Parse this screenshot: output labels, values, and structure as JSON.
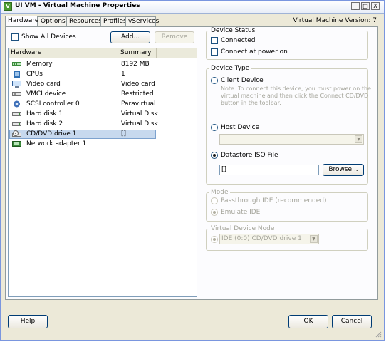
{
  "window": {
    "title": "UI VM - Virtual Machine Properties",
    "minimize": "_",
    "maximize": "□",
    "close": "X"
  },
  "tabs": [
    "Hardware",
    "Options",
    "Resources",
    "Profiles",
    "vServices"
  ],
  "version_label": "Virtual Machine Version: 7",
  "hardware": {
    "show_all_label": "Show All Devices",
    "show_all_checked": false,
    "add_label": "Add...",
    "remove_label": "Remove",
    "col_hardware": "Hardware",
    "col_summary": "Summary",
    "rows": [
      {
        "name": "Memory",
        "summary": "8192 MB",
        "icon": "memory-icon"
      },
      {
        "name": "CPUs",
        "summary": "1",
        "icon": "cpu-icon"
      },
      {
        "name": "Video card",
        "summary": "Video card",
        "icon": "video-card-icon"
      },
      {
        "name": "VMCI device",
        "summary": "Restricted",
        "icon": "vmci-device-icon"
      },
      {
        "name": "SCSI controller 0",
        "summary": "Paravirtual",
        "icon": "scsi-controller-icon"
      },
      {
        "name": "Hard disk 1",
        "summary": "Virtual Disk",
        "icon": "hard-disk-icon"
      },
      {
        "name": "Hard disk 2",
        "summary": "Virtual Disk",
        "icon": "hard-disk-icon"
      },
      {
        "name": "CD/DVD drive 1",
        "summary": "[]",
        "icon": "cd-dvd-icon",
        "selected": true
      },
      {
        "name": "Network adapter 1",
        "summary": "",
        "icon": "network-adapter-icon"
      }
    ]
  },
  "device_status": {
    "title": "Device Status",
    "connected": "Connected",
    "connect_at_power_on": "Connect at power on"
  },
  "device_type": {
    "title": "Device Type",
    "client_device": "Client Device",
    "note": [
      "Note: To connect this device, you must power on the",
      "virtual machine and then click the Connect CD/DVD",
      "button in the toolbar."
    ],
    "host_device": "Host Device",
    "datastore_iso": "Datastore ISO File",
    "iso_value": "[]",
    "browse": "Browse...",
    "selected": "datastore_iso"
  },
  "mode": {
    "title": "Mode",
    "passthrough": "Passthrough IDE (recommended)",
    "emulate": "Emulate IDE"
  },
  "virtual_device_node": {
    "title": "Virtual Device Node",
    "value": "IDE (0:0) CD/DVD drive 1"
  },
  "footer": {
    "help": "Help",
    "ok": "OK",
    "cancel": "Cancel"
  },
  "colors": {
    "selection": "#c7d9ee",
    "title_bar": "#e8eef8",
    "dialog_bg": "#ece9d8"
  }
}
